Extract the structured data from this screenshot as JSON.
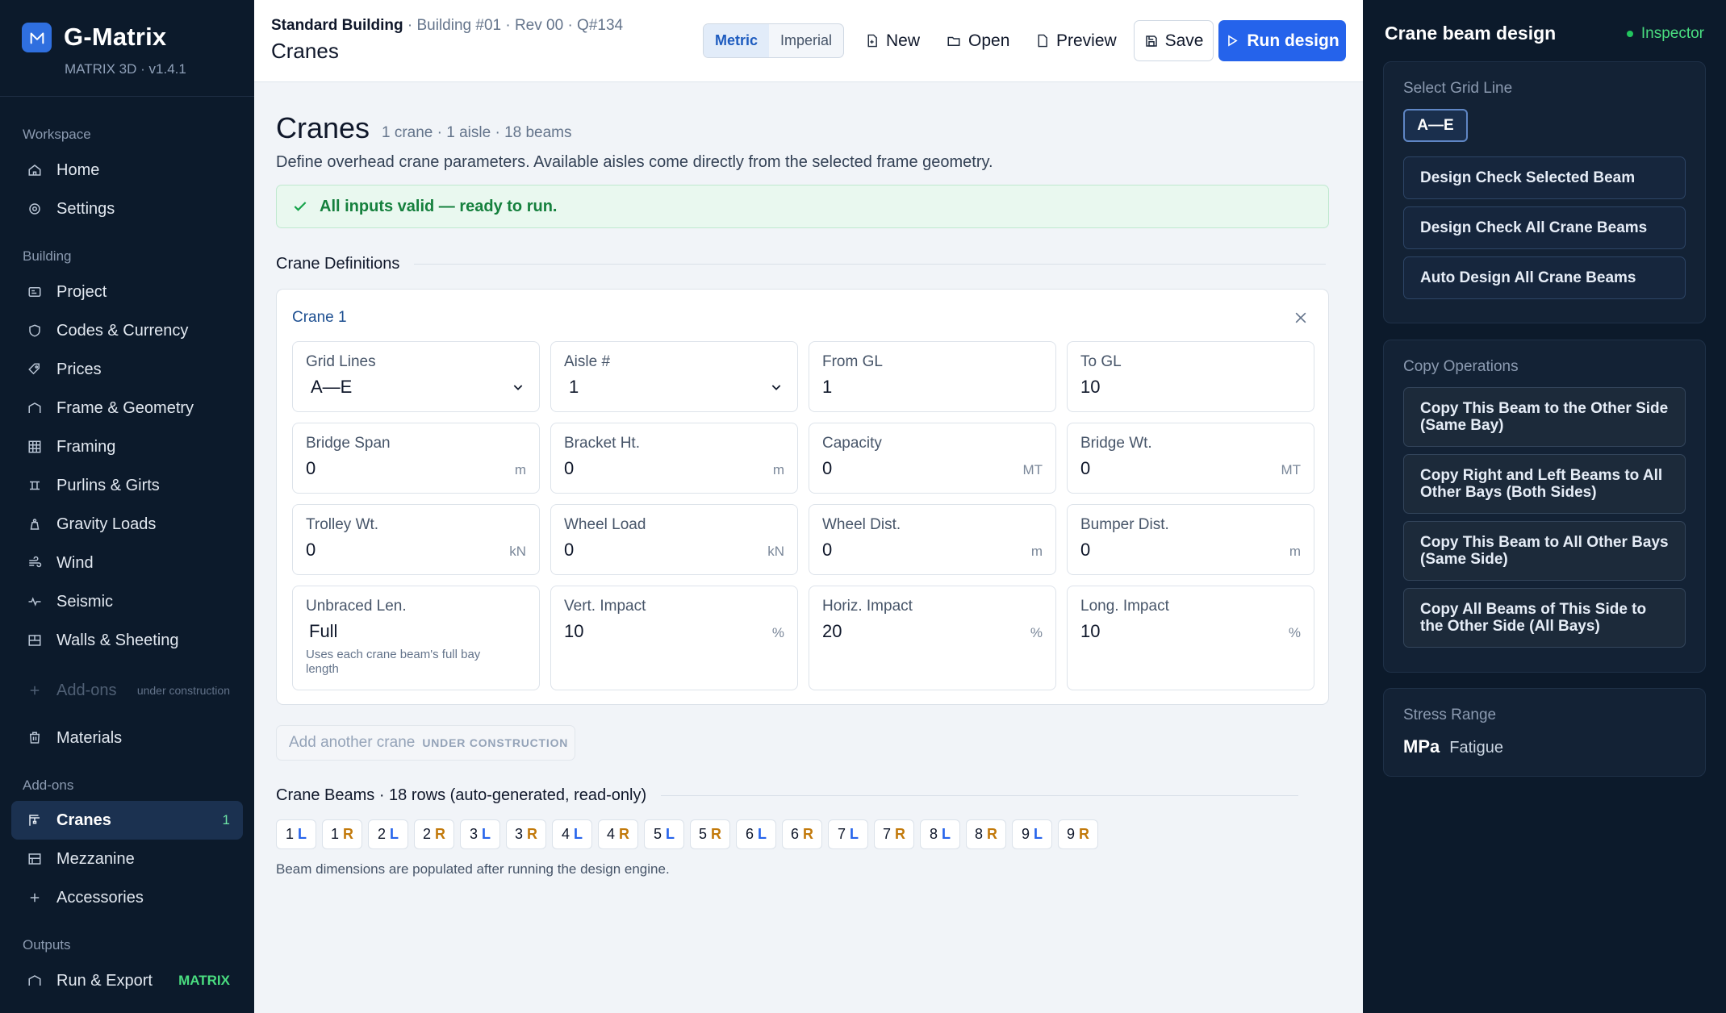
{
  "brand": {
    "name": "G-Matrix",
    "version": "MATRIX 3D · v1.4.1"
  },
  "nav": {
    "sections": {
      "workspace": "Workspace",
      "building": "Building",
      "addons": "Add-ons",
      "outputs": "Outputs"
    },
    "items": {
      "home": "Home",
      "settings": "Settings",
      "project": "Project",
      "codes": "Codes & Currency",
      "prices": "Prices",
      "frame": "Frame & Geometry",
      "framing": "Framing",
      "purlins": "Purlins & Girts",
      "gravity": "Gravity Loads",
      "wind": "Wind",
      "seismic": "Seismic",
      "walls": "Walls & Sheeting",
      "addons_disabled": "Add-ons",
      "addons_disabled_tag": "under construction",
      "materials": "Materials",
      "cranes": "Cranes",
      "cranes_count": "1",
      "mezzanine": "Mezzanine",
      "accessories": "Accessories",
      "run_export": "Run & Export",
      "run_export_tag": "MATRIX"
    }
  },
  "header": {
    "crumb_main": "Standard Building",
    "crumb_rest": " · Building #01 · Rev 00 · Q#134",
    "page": "Cranes",
    "units": [
      "Metric",
      "Imperial"
    ],
    "new": "New",
    "open": "Open",
    "preview": "Preview",
    "save": "Save",
    "run": "Run design"
  },
  "main": {
    "title": "Cranes",
    "meta": "1 crane · 1 aisle · 18 beams",
    "description": "Define overhead crane parameters. Available aisles come directly from the selected frame geometry.",
    "valid": "All inputs valid — ready to run.",
    "sec_definitions": "Crane Definitions",
    "crane_name": "Crane 1",
    "fields": {
      "grid_lines": {
        "label": "Grid Lines",
        "value": "A—E"
      },
      "aisle": {
        "label": "Aisle #",
        "value": "1"
      },
      "from_gl": {
        "label": "From GL",
        "value": "1"
      },
      "to_gl": {
        "label": "To GL",
        "value": "10"
      },
      "bridge_span": {
        "label": "Bridge Span",
        "value": "0",
        "unit": "m"
      },
      "bracket_ht": {
        "label": "Bracket Ht.",
        "value": "0",
        "unit": "m"
      },
      "capacity": {
        "label": "Capacity",
        "value": "0",
        "unit": "MT"
      },
      "bridge_wt": {
        "label": "Bridge Wt.",
        "value": "0",
        "unit": "MT"
      },
      "trolley_wt": {
        "label": "Trolley Wt.",
        "value": "0",
        "unit": "kN"
      },
      "wheel_load": {
        "label": "Wheel Load",
        "value": "0",
        "unit": "kN"
      },
      "wheel_dist": {
        "label": "Wheel Dist.",
        "value": "0",
        "unit": "m"
      },
      "bumper_dist": {
        "label": "Bumper Dist.",
        "value": "0",
        "unit": "m"
      },
      "unbraced": {
        "label": "Unbraced Len.",
        "value": "Full",
        "hint": "Uses each crane beam's full bay length"
      },
      "vert_impact": {
        "label": "Vert. Impact",
        "value": "10",
        "unit": "%"
      },
      "horiz_impact": {
        "label": "Horiz. Impact",
        "value": "20",
        "unit": "%"
      },
      "long_impact": {
        "label": "Long. Impact",
        "value": "10",
        "unit": "%"
      }
    },
    "add_crane": "Add another crane",
    "add_crane_tag": "UNDER CONSTRUCTION",
    "sec_beams": "Crane Beams · 18 rows (auto-generated, read-only)",
    "beams": [
      {
        "n": "1",
        "s": "L"
      },
      {
        "n": "1",
        "s": "R"
      },
      {
        "n": "2",
        "s": "L"
      },
      {
        "n": "2",
        "s": "R"
      },
      {
        "n": "3",
        "s": "L"
      },
      {
        "n": "3",
        "s": "R"
      },
      {
        "n": "4",
        "s": "L"
      },
      {
        "n": "4",
        "s": "R"
      },
      {
        "n": "5",
        "s": "L"
      },
      {
        "n": "5",
        "s": "R"
      },
      {
        "n": "6",
        "s": "L"
      },
      {
        "n": "6",
        "s": "R"
      },
      {
        "n": "7",
        "s": "L"
      },
      {
        "n": "7",
        "s": "R"
      },
      {
        "n": "8",
        "s": "L"
      },
      {
        "n": "8",
        "s": "R"
      },
      {
        "n": "9",
        "s": "L"
      },
      {
        "n": "9",
        "s": "R"
      }
    ],
    "beam_note": "Beam dimensions are populated after running the design engine."
  },
  "inspector": {
    "title": "Crane beam design",
    "badge": "Inspector",
    "select_gl": "Select Grid Line",
    "gl_value": "A—E",
    "design_selected": "Design Check Selected Beam",
    "design_all": "Design Check All Crane Beams",
    "auto_design": "Auto Design All Crane Beams",
    "copy_ops": "Copy Operations",
    "copy1": "Copy This Beam to the Other Side (Same Bay)",
    "copy2": "Copy Right and Left Beams to All Other Bays (Both Sides)",
    "copy3": "Copy This Beam to All Other Bays (Same Side)",
    "copy4": "Copy All Beams of This Side to the Other Side (All Bays)",
    "stress_range": "Stress Range",
    "stress_unit": "MPa",
    "stress_type": "Fatigue"
  },
  "colors": {
    "accent": "#2563eb",
    "sidebar": "#0c1a2b",
    "success": "#15803d",
    "left_side": "#2563eb",
    "right_side": "#c2790a"
  }
}
